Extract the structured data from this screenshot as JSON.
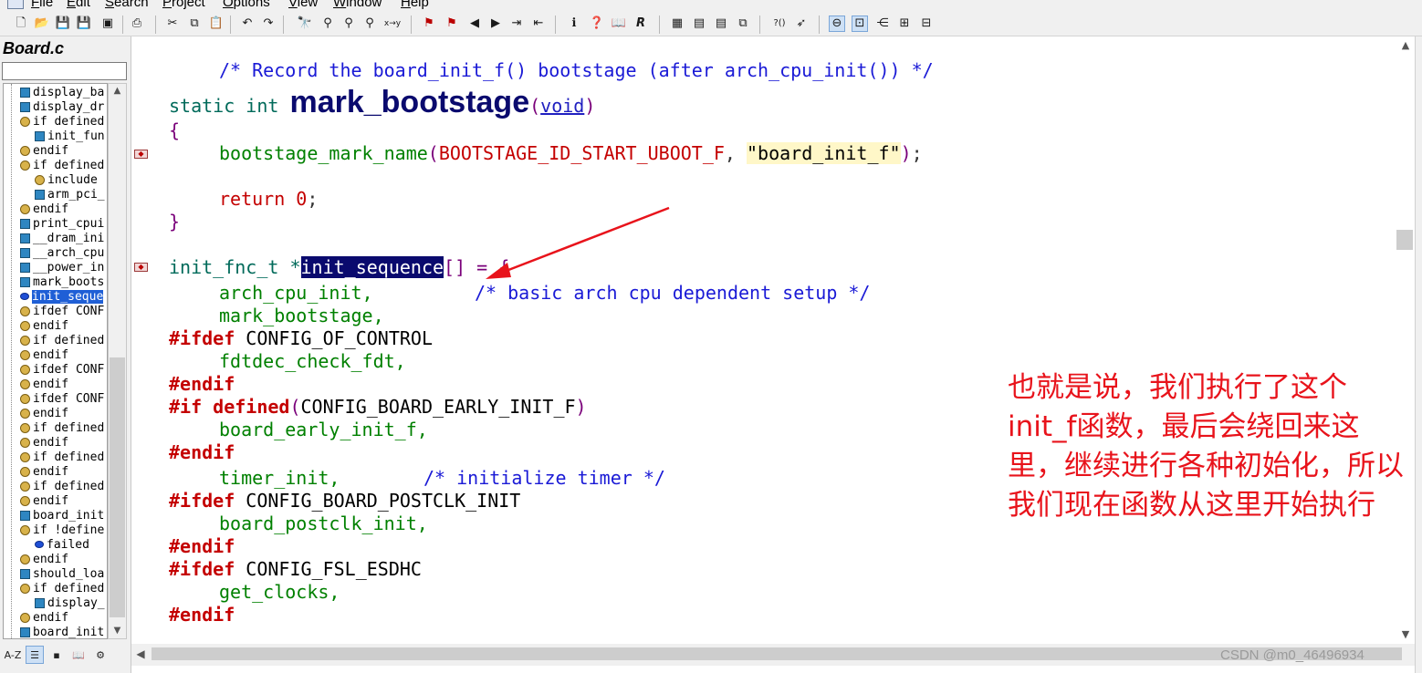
{
  "menu": [
    "File",
    "Edit",
    "Search",
    "Project",
    "Options",
    "View",
    "Window",
    "Help"
  ],
  "toolbar_icons": [
    "new-file-icon",
    "open-folder-icon",
    "save-icon",
    "save-all-icon",
    "close-file-icon",
    "print-icon",
    "cut-icon",
    "copy-icon",
    "paste-icon",
    "undo-icon",
    "redo-icon",
    "find-icon",
    "find-next-icon",
    "find-prev-icon",
    "find-files-icon",
    "replace-icon",
    "bookmark-toggle-icon",
    "bookmark-next-icon",
    "back-icon",
    "forward-icon",
    "indent-icon",
    "outdent-icon",
    "symbol-info-icon",
    "jump-def-icon",
    "browse-icon",
    "references-icon",
    "layout-1-icon",
    "layout-2-icon",
    "layout-3-icon",
    "layout-4-icon",
    "context-help-icon",
    "help-pointer-icon",
    "sync-icon",
    "relation-icon",
    "call-graph-icon",
    "class-tree-icon",
    "project-icon"
  ],
  "left_panel": {
    "title": "Board.c",
    "search_value": "",
    "symbols": [
      {
        "type": "fn",
        "label": "display_ba",
        "indent": 1
      },
      {
        "type": "fn",
        "label": "display_dr",
        "indent": 1
      },
      {
        "type": "pp",
        "label": "if defined",
        "indent": 1
      },
      {
        "type": "fn",
        "label": "init_fun",
        "indent": 2
      },
      {
        "type": "pp",
        "label": "endif",
        "indent": 1
      },
      {
        "type": "pp",
        "label": "if defined",
        "indent": 1
      },
      {
        "type": "pp",
        "label": "include",
        "indent": 2
      },
      {
        "type": "fn",
        "label": "arm_pci_",
        "indent": 2
      },
      {
        "type": "pp",
        "label": "endif",
        "indent": 1
      },
      {
        "type": "fn",
        "label": "print_cpui",
        "indent": 1
      },
      {
        "type": "fn",
        "label": "__dram_ini",
        "indent": 1
      },
      {
        "type": "fn",
        "label": "__arch_cpu",
        "indent": 1
      },
      {
        "type": "fn",
        "label": "__power_in",
        "indent": 1
      },
      {
        "type": "fn",
        "label": "mark_boots",
        "indent": 1
      },
      {
        "type": "var",
        "label": "init_seque",
        "indent": 1,
        "selected": true
      },
      {
        "type": "pp",
        "label": "ifdef CONF",
        "indent": 1
      },
      {
        "type": "pp",
        "label": "endif",
        "indent": 1
      },
      {
        "type": "pp",
        "label": "if defined",
        "indent": 1
      },
      {
        "type": "pp",
        "label": "endif",
        "indent": 1
      },
      {
        "type": "pp",
        "label": "ifdef CONF",
        "indent": 1
      },
      {
        "type": "pp",
        "label": "endif",
        "indent": 1
      },
      {
        "type": "pp",
        "label": "ifdef CONF",
        "indent": 1
      },
      {
        "type": "pp",
        "label": "endif",
        "indent": 1
      },
      {
        "type": "pp",
        "label": "if defined",
        "indent": 1
      },
      {
        "type": "pp",
        "label": "endif",
        "indent": 1
      },
      {
        "type": "pp",
        "label": "if defined",
        "indent": 1
      },
      {
        "type": "pp",
        "label": "endif",
        "indent": 1
      },
      {
        "type": "pp",
        "label": "if defined",
        "indent": 1
      },
      {
        "type": "pp",
        "label": "endif",
        "indent": 1
      },
      {
        "type": "fn",
        "label": "board_init",
        "indent": 1
      },
      {
        "type": "pp",
        "label": "if !define",
        "indent": 1
      },
      {
        "type": "var",
        "label": "failed",
        "indent": 2
      },
      {
        "type": "pp",
        "label": "endif",
        "indent": 1
      },
      {
        "type": "fn",
        "label": "should_loa",
        "indent": 1
      },
      {
        "type": "pp",
        "label": "if defined",
        "indent": 1
      },
      {
        "type": "fn",
        "label": "display_",
        "indent": 2
      },
      {
        "type": "pp",
        "label": "endif",
        "indent": 1
      },
      {
        "type": "fn",
        "label": "board_init",
        "indent": 1
      }
    ],
    "bottom_buttons": [
      "A-Z",
      "list-icon",
      "category-icon",
      "book-icon",
      "properties-icon"
    ]
  },
  "code": {
    "comment_line": "/* Record the board_init_f() bootstage (after arch_cpu_init()) */",
    "decl_kw": "static int",
    "decl_name": "mark_bootstage",
    "decl_param": "void",
    "open_brace": "{",
    "call_name": "bootstage_mark_name",
    "call_macro": "BOOTSTAGE_ID_START_UBOOT_F",
    "call_string": "\"board_init_f\"",
    "return_kw": "return",
    "return_val": "0",
    "close_brace": "}",
    "seq_type": "init_fnc_t *",
    "seq_name": "init_sequence",
    "seq_rest": "[] = {",
    "l_arch_cpu_init": "arch_cpu_init,",
    "l_arch_cpu_comment": "/* basic arch cpu dependent setup */",
    "l_mark_bootstage": "mark_bootstage,",
    "l_ifdef1": "#ifdef",
    "l_cfg1": "CONFIG_OF_CONTROL",
    "l_fdtdec": "fdtdec_check_fdt,",
    "l_endif1": "#endif",
    "l_if2": "#if defined",
    "l_cfg2": "CONFIG_BOARD_EARLY_INIT_F",
    "l_board_early": "board_early_init_f,",
    "l_endif2": "#endif",
    "l_timer": "timer_init,",
    "l_timer_comment": "/* initialize timer */",
    "l_ifdef3": "#ifdef",
    "l_cfg3": "CONFIG_BOARD_POSTCLK_INIT",
    "l_postclk": "board_postclk_init,",
    "l_endif3": "#endif",
    "l_ifdef4": "#ifdef",
    "l_cfg4": "CONFIG_FSL_ESDHC",
    "l_clocks": "get_clocks,",
    "l_endif4": "#endif"
  },
  "annotation": {
    "text": "也就是说，我们执行了这个init_f函数，最后会绕回来这里，继续进行各种初始化，所以我们现在函数从这里开始执行",
    "color": "#e8131b"
  },
  "watermark": "CSDN @m0_46496934"
}
